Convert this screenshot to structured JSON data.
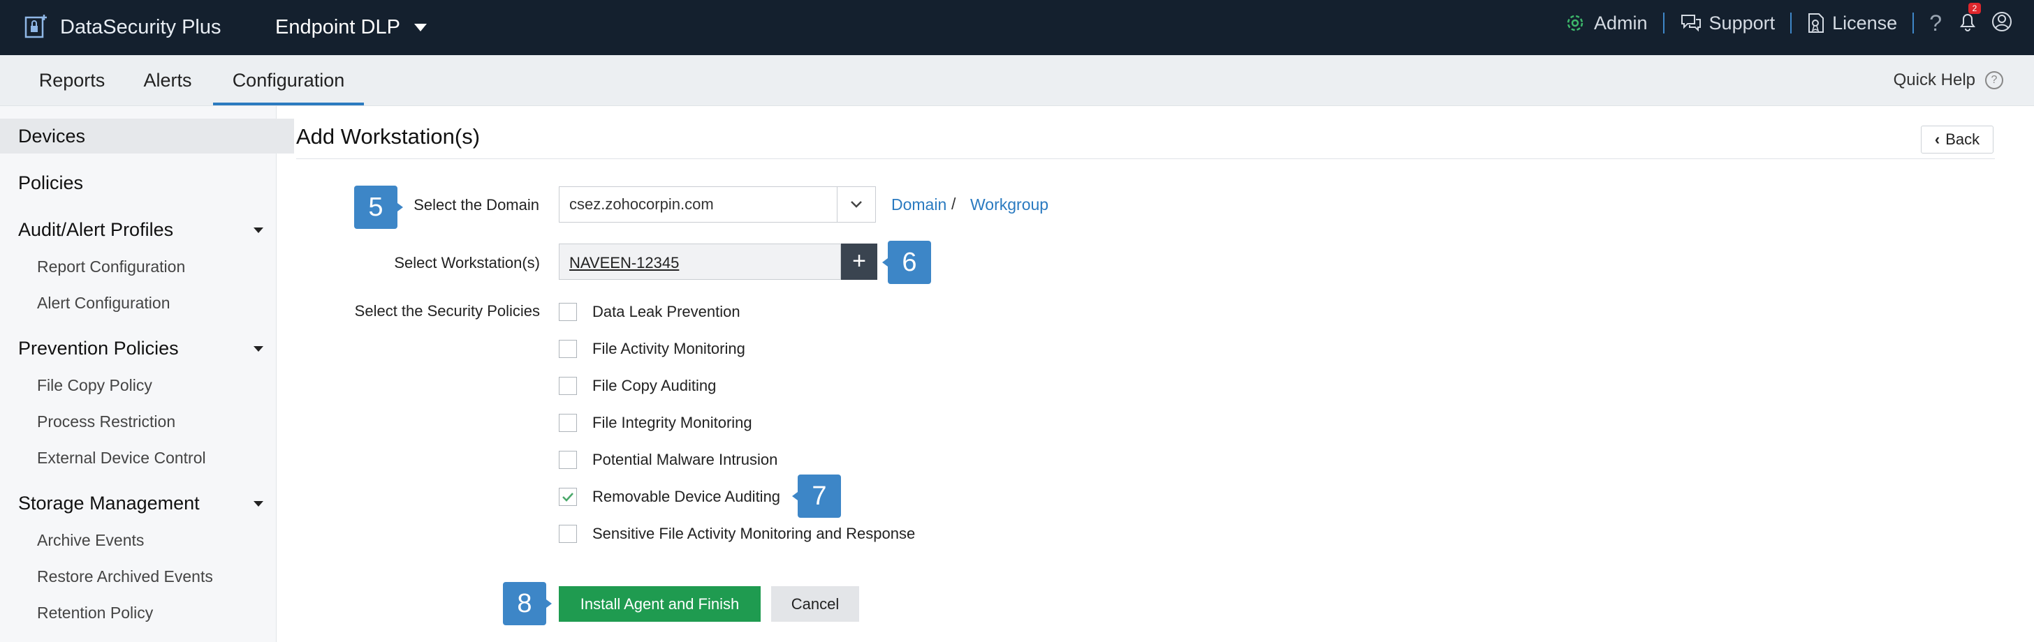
{
  "app": {
    "brand": "DataSecurity Plus",
    "product": "Endpoint DLP",
    "topright": {
      "admin": "Admin",
      "support": "Support",
      "license": "License",
      "help": "?",
      "notification_count": "2"
    }
  },
  "nav": {
    "tabs": [
      {
        "label": "Reports"
      },
      {
        "label": "Alerts"
      },
      {
        "label": "Configuration",
        "active": true
      }
    ],
    "quick_help": "Quick Help",
    "quick_help_icon": "?"
  },
  "sidebar": {
    "devices": "Devices",
    "policies": "Policies",
    "audit_alert_profiles": "Audit/Alert Profiles",
    "report_configuration": "Report Configuration",
    "alert_configuration": "Alert Configuration",
    "prevention_policies": "Prevention Policies",
    "file_copy_policy": "File Copy Policy",
    "process_restriction": "Process Restriction",
    "external_device_control": "External Device Control",
    "storage_management": "Storage Management",
    "archive_events": "Archive Events",
    "restore_archived_events": "Restore Archived Events",
    "retention_policy": "Retention Policy"
  },
  "main": {
    "title": "Add Workstation(s)",
    "back": "Back",
    "domain_label": "Select the Domain",
    "domain_value": "csez.zohocorpin.com",
    "domain_link": "Domain",
    "slash": "/",
    "workgroup_link": "Workgroup",
    "workstations_label": "Select Workstation(s)",
    "workstation_value": "NAVEEN-12345",
    "plus": "+",
    "policies_label": "Select the Security Policies",
    "policies": [
      {
        "label": "Data Leak Prevention",
        "checked": false
      },
      {
        "label": "File Activity Monitoring",
        "checked": false
      },
      {
        "label": "File Copy Auditing",
        "checked": false
      },
      {
        "label": "File Integrity Monitoring",
        "checked": false
      },
      {
        "label": "Potential Malware Intrusion",
        "checked": false
      },
      {
        "label": "Removable Device Auditing",
        "checked": true
      },
      {
        "label": "Sensitive File Activity Monitoring and Response",
        "checked": false
      }
    ],
    "install_button": "Install Agent and Finish",
    "cancel_button": "Cancel"
  },
  "steps": {
    "s5": "5",
    "s6": "6",
    "s7": "7",
    "s8": "8"
  },
  "colors": {
    "topbar": "#14202e",
    "accent": "#2c7bc0",
    "badge": "#3d86c7",
    "primary_button": "#1f9b50"
  }
}
